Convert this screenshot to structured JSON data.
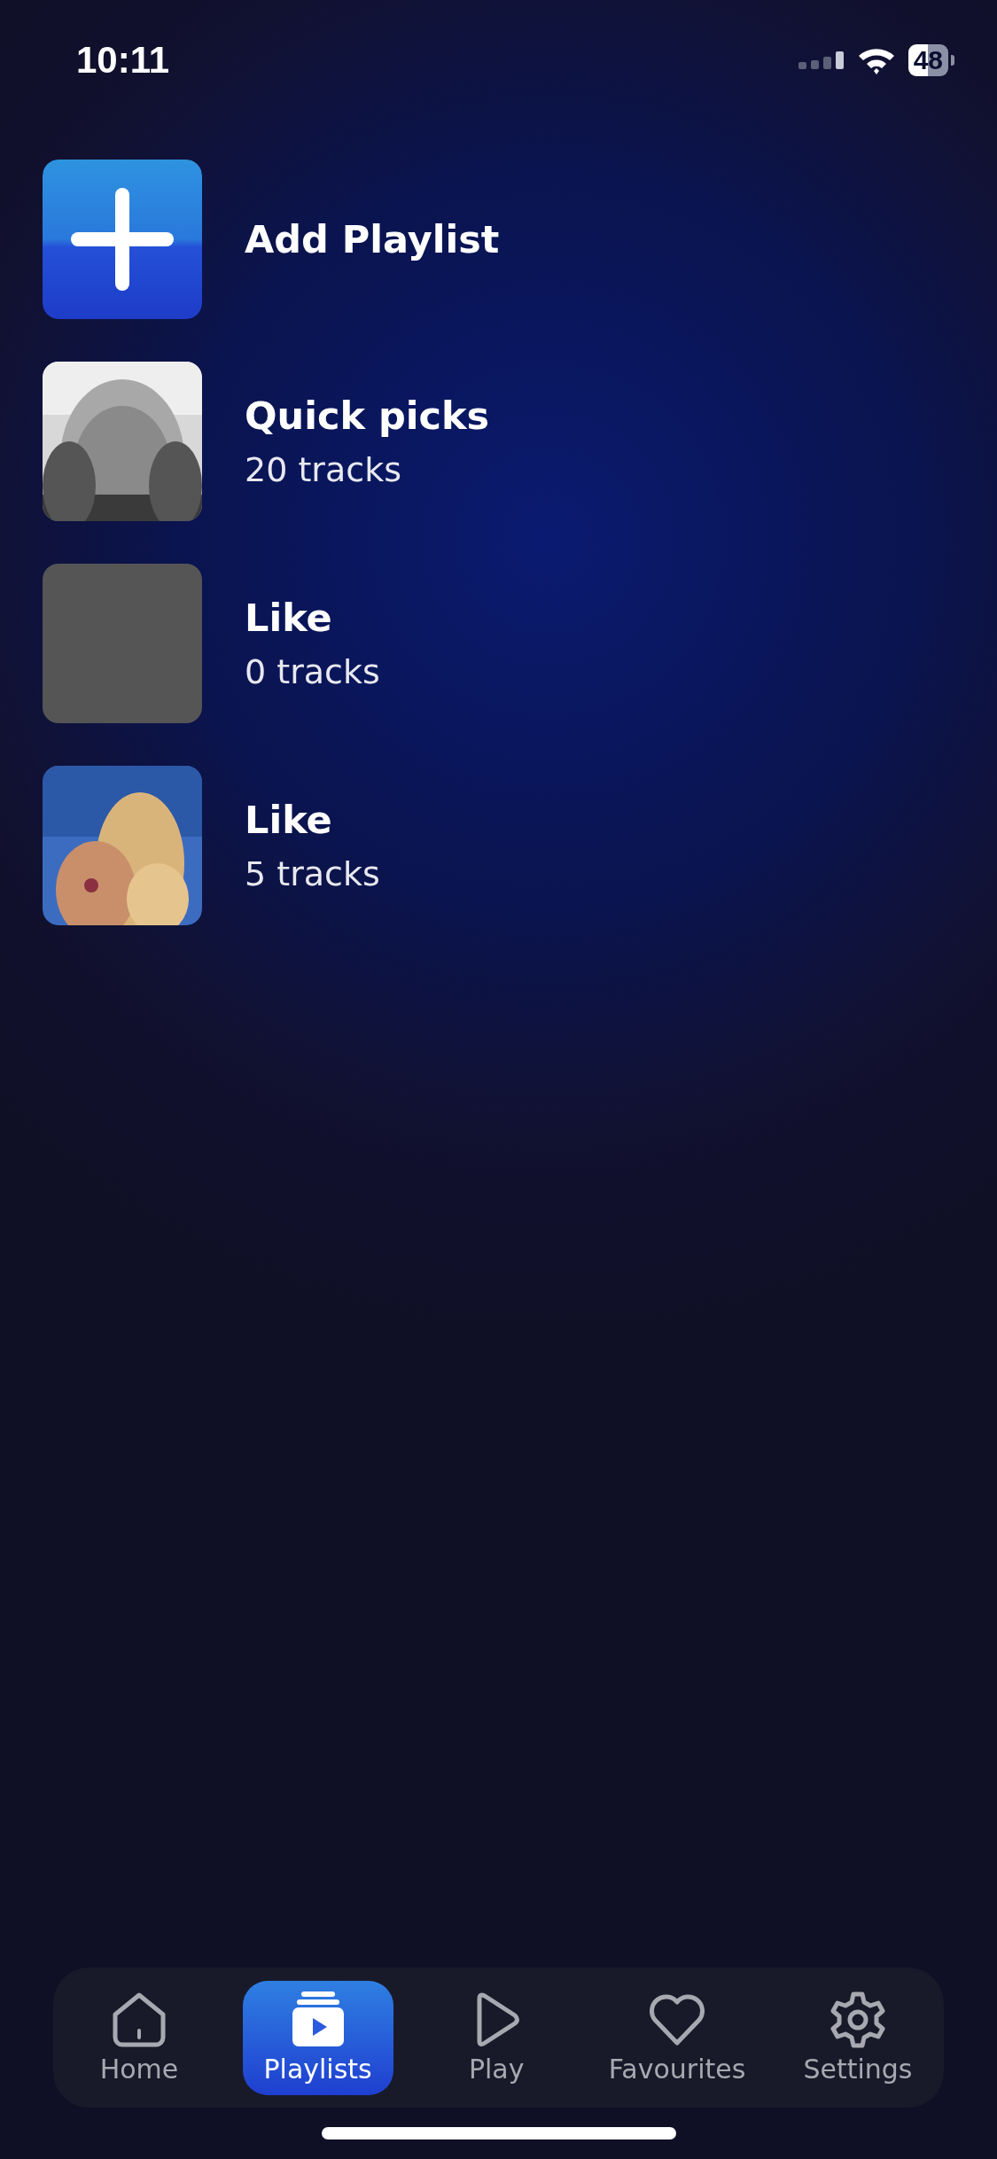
{
  "status_bar": {
    "time": "10:11",
    "battery": "48"
  },
  "playlists": [
    {
      "kind": "add",
      "title": "Add Playlist"
    },
    {
      "kind": "picture",
      "title": "Quick picks",
      "subtitle": "20 tracks"
    },
    {
      "kind": "empty",
      "title": "Like",
      "subtitle": "0 tracks"
    },
    {
      "kind": "picture",
      "title": "Like",
      "subtitle": "5 tracks"
    }
  ],
  "tab_bar": [
    {
      "kind": "home",
      "label": "Home",
      "selected": false
    },
    {
      "kind": "playlists",
      "label": "Playlists",
      "selected": true
    },
    {
      "kind": "play",
      "label": "Play",
      "selected": false
    },
    {
      "kind": "heart",
      "label": "Favourites",
      "selected": false
    },
    {
      "kind": "gear",
      "label": "Settings",
      "selected": false
    }
  ]
}
